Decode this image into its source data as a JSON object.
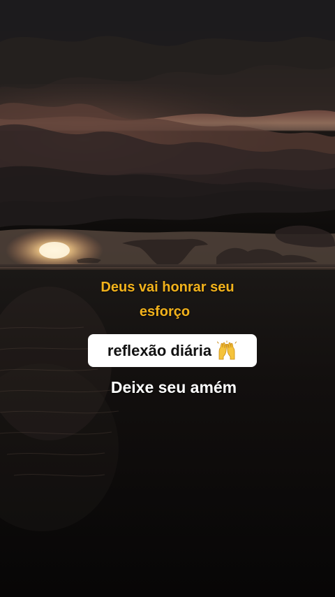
{
  "post": {
    "headline_line1": "Deus vai honrar seu",
    "headline_line2": "esforço",
    "chip_label": "reflexão diária",
    "chip_emoji_icon": "raising-hands-icon",
    "call_to_action": "Deixe seu amém"
  },
  "colors": {
    "headline": "#f2b21b",
    "chip_background": "#ffffff",
    "chip_text": "#111111",
    "call_to_action": "#ffffff",
    "sky_dark": "#2a2524",
    "sun_glow": "#ffe2a8",
    "sea": "#0d0b0a"
  }
}
